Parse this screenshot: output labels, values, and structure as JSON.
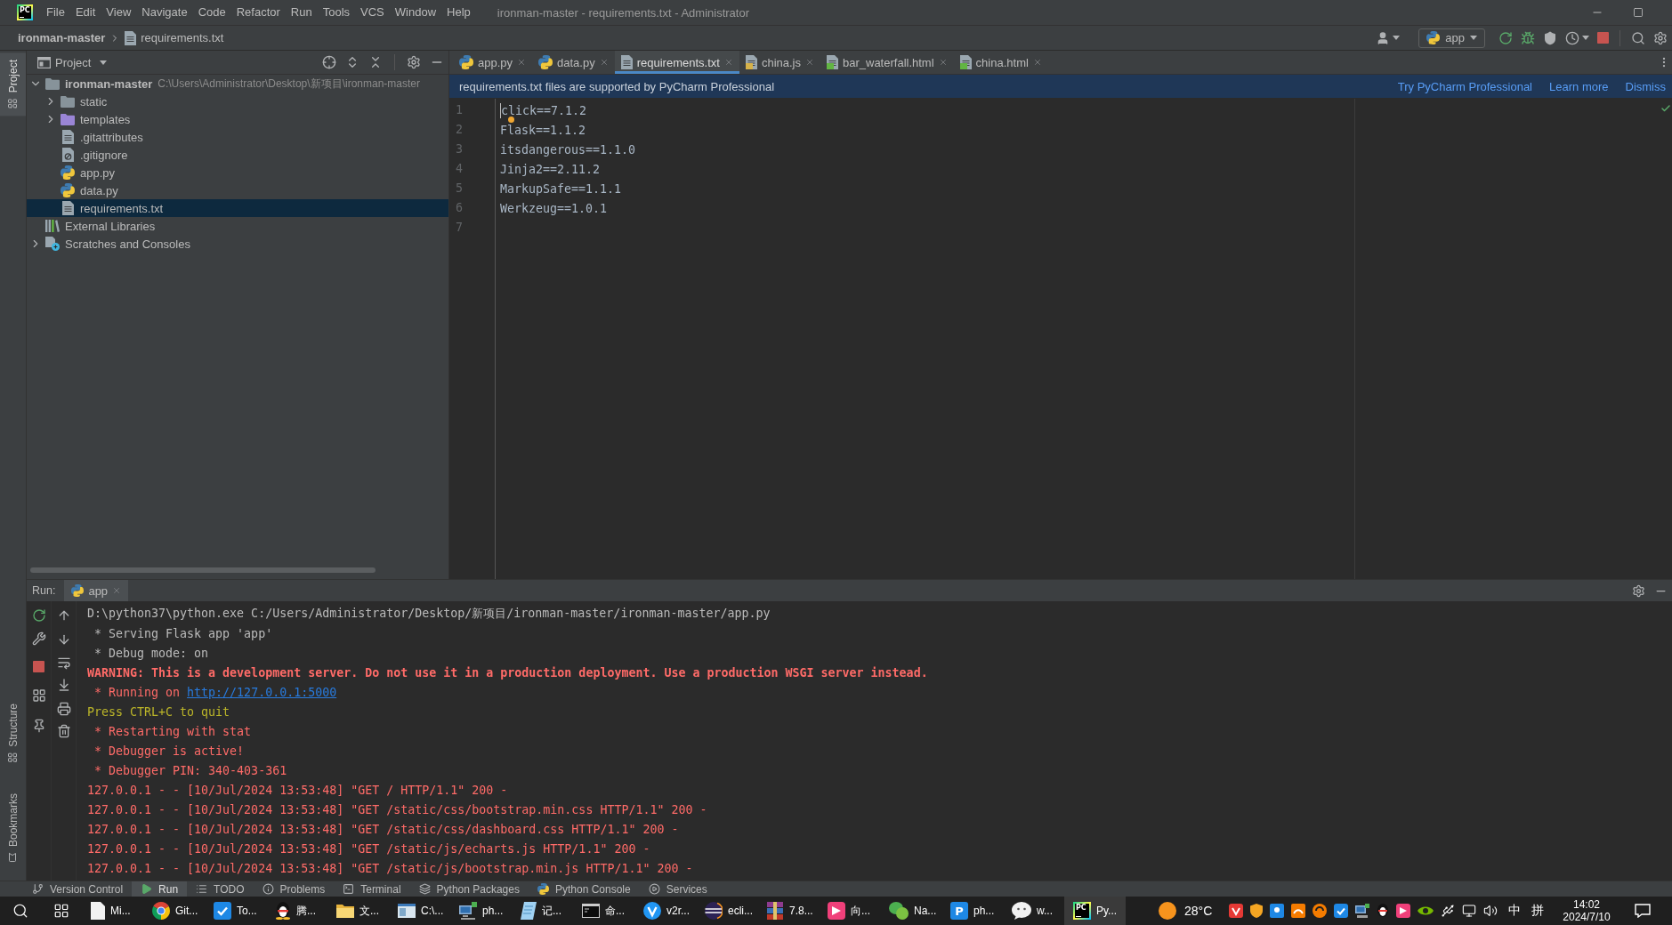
{
  "title_bar": {
    "logo": "PC",
    "menu": [
      "File",
      "Edit",
      "View",
      "Navigate",
      "Code",
      "Refactor",
      "Run",
      "Tools",
      "VCS",
      "Window",
      "Help"
    ],
    "title": "ironman-master - requirements.txt - Administrator"
  },
  "nav_bar": {
    "breadcrumbs": [
      {
        "label": "ironman-master",
        "kind": "project"
      },
      {
        "label": "requirements.txt",
        "kind": "text"
      }
    ],
    "run_config": "app"
  },
  "left_strip": {
    "top": [
      {
        "label": "Project",
        "kind": "project",
        "selected": true
      }
    ],
    "bottom": [
      {
        "label": "Structure",
        "kind": "structure",
        "selected": false
      },
      {
        "label": "Bookmarks",
        "kind": "bookmarks",
        "selected": false
      }
    ]
  },
  "project_panel": {
    "title": "Project",
    "tree": [
      {
        "name": "ironman-master",
        "path": "C:\\Users\\Administrator\\Desktop\\新项目\\ironman-master",
        "kind": "folder",
        "expanded": true,
        "selected": false,
        "children": [
          {
            "name": "static",
            "kind": "folder",
            "expanded": false,
            "selected": false
          },
          {
            "name": "templates",
            "kind": "template-folder",
            "expanded": false,
            "selected": false
          },
          {
            "name": ".gitattributes",
            "kind": "text",
            "selected": false
          },
          {
            "name": ".gitignore",
            "kind": "ignore",
            "selected": false
          },
          {
            "name": "app.py",
            "kind": "python",
            "selected": false
          },
          {
            "name": "data.py",
            "kind": "python",
            "selected": false
          },
          {
            "name": "requirements.txt",
            "kind": "text",
            "selected": true
          }
        ]
      },
      {
        "name": "External Libraries",
        "kind": "library",
        "selected": false
      },
      {
        "name": "Scratches and Consoles",
        "kind": "scratches",
        "expanded": false,
        "selected": false
      }
    ]
  },
  "editor": {
    "tabs": [
      {
        "label": "app.py",
        "kind": "python",
        "selected": false
      },
      {
        "label": "data.py",
        "kind": "python",
        "selected": false
      },
      {
        "label": "requirements.txt",
        "kind": "text",
        "selected": true
      },
      {
        "label": "china.js",
        "kind": "script",
        "selected": false
      },
      {
        "label": "bar_waterfall.html",
        "kind": "web",
        "selected": false
      },
      {
        "label": "china.html",
        "kind": "web",
        "selected": false
      }
    ],
    "banner": {
      "message": "requirements.txt files are supported by PyCharm Professional",
      "links": [
        "Try PyCharm Professional",
        "Learn more",
        "Dismiss"
      ]
    },
    "lines": [
      {
        "number": "1",
        "text": "click==7.1.2",
        "cursor": true
      },
      {
        "number": "2",
        "text": "Flask==1.1.2",
        "cursor": false
      },
      {
        "number": "3",
        "text": "itsdangerous==1.1.0",
        "cursor": false
      },
      {
        "number": "4",
        "text": "Jinja2==2.11.2",
        "cursor": false
      },
      {
        "number": "5",
        "text": "MarkupSafe==1.1.1",
        "cursor": false
      },
      {
        "number": "6",
        "text": "Werkzeug==1.0.1",
        "cursor": false
      },
      {
        "number": "7",
        "cursor": false
      }
    ]
  },
  "run_panel": {
    "label": "Run:",
    "tabs": [
      {
        "label": "app",
        "selected": true
      }
    ],
    "console": [
      {
        "kind": "plain",
        "text": "D:\\python37\\python.exe C:/Users/Administrator/Desktop/新项目/ironman-master/ironman-master/app.py"
      },
      {
        "kind": "plain",
        "text": " * Serving Flask app 'app'"
      },
      {
        "kind": "plain",
        "text": " * Debug mode: on"
      },
      {
        "kind": "warning",
        "text": "WARNING: This is a development server. Do not use it in a production deployment. Use a production WSGI server instead."
      },
      {
        "kind": "error",
        "text": " * Running on",
        "link": "http://127.0.0.1:5000"
      },
      {
        "kind": "hint",
        "text": "Press CTRL+C to quit"
      },
      {
        "kind": "error",
        "text": " * Restarting with stat"
      },
      {
        "kind": "error",
        "text": " * Debugger is active!"
      },
      {
        "kind": "error",
        "text": " * Debugger PIN: 340-403-361"
      },
      {
        "kind": "error",
        "text": "127.0.0.1 - - [10/Jul/2024 13:53:48] \"GET / HTTP/1.1\" 200 -"
      },
      {
        "kind": "error",
        "text": "127.0.0.1 - - [10/Jul/2024 13:53:48] \"GET /static/css/bootstrap.min.css HTTP/1.1\" 200 -"
      },
      {
        "kind": "error",
        "text": "127.0.0.1 - - [10/Jul/2024 13:53:48] \"GET /static/css/dashboard.css HTTP/1.1\" 200 -"
      },
      {
        "kind": "error",
        "text": "127.0.0.1 - - [10/Jul/2024 13:53:48] \"GET /static/js/echarts.js HTTP/1.1\" 200 -"
      },
      {
        "kind": "error",
        "text": "127.0.0.1 - - [10/Jul/2024 13:53:48] \"GET /static/js/bootstrap.min.js HTTP/1.1\" 200 -"
      }
    ]
  },
  "tool_tabs": [
    {
      "label": "Version Control",
      "kind": "vcs",
      "selected": false
    },
    {
      "label": "Run",
      "kind": "run",
      "selected": true
    },
    {
      "label": "TODO",
      "kind": "todo",
      "selected": false
    },
    {
      "label": "Problems",
      "kind": "problems",
      "selected": false
    },
    {
      "label": "Terminal",
      "kind": "terminal",
      "selected": false
    },
    {
      "label": "Python Packages",
      "kind": "packages",
      "selected": false
    },
    {
      "label": "Python Console",
      "kind": "python",
      "selected": false
    },
    {
      "label": "Services",
      "kind": "services",
      "selected": false
    }
  ],
  "taskbar": {
    "apps": [
      {
        "label": "Mi...",
        "kind": "document",
        "selected": false
      },
      {
        "label": "Git...",
        "kind": "browser",
        "selected": false
      },
      {
        "label": "To...",
        "kind": "check-tile",
        "selected": false
      },
      {
        "label": "腾...",
        "kind": "penguin",
        "selected": false
      },
      {
        "label": "文...",
        "kind": "folder",
        "selected": false
      },
      {
        "label": "C:\\...",
        "kind": "window",
        "selected": false
      },
      {
        "label": "ph...",
        "kind": "computer",
        "selected": false
      },
      {
        "label": "记...",
        "kind": "notepad",
        "selected": false
      },
      {
        "label": "命...",
        "kind": "terminal",
        "selected": false
      },
      {
        "label": "v2r...",
        "kind": "badge",
        "selected": false
      },
      {
        "label": "ecli...",
        "kind": "striped-circle",
        "selected": false
      },
      {
        "label": "7.8...",
        "kind": "archive",
        "selected": false
      },
      {
        "label": "向...",
        "kind": "pink-tile",
        "selected": false
      },
      {
        "label": "Na...",
        "kind": "blob",
        "selected": false
      },
      {
        "label": "ph...",
        "kind": "letter-tile",
        "logo": "P",
        "selected": false
      },
      {
        "label": "w...",
        "kind": "chat",
        "selected": false
      },
      {
        "label": "Py...",
        "kind": "ide",
        "logo": "PC",
        "selected": true
      }
    ],
    "weather": "28°C",
    "input_indicators": [
      "中",
      "拼"
    ],
    "time": "14:02",
    "date": "2024/7/10"
  }
}
